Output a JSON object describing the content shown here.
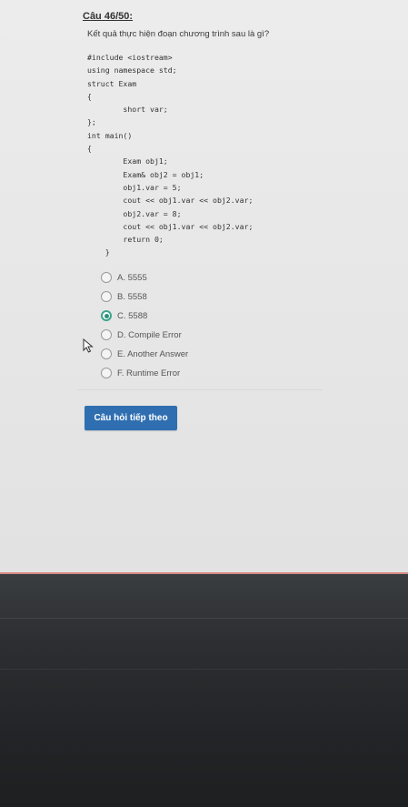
{
  "question": {
    "number": "Câu 46/50:",
    "text": "Kết quả thực hiện đoạn chương trình sau là gì?"
  },
  "code_lines": [
    "#include <iostream>",
    "using namespace std;",
    "struct Exam",
    "{",
    "        short var;",
    "};",
    "int main()",
    "{",
    "        Exam obj1;",
    "        Exam& obj2 = obj1;",
    "        obj1.var = 5;",
    "        cout << obj1.var << obj2.var;",
    "        obj2.var = 8;",
    "        cout << obj1.var << obj2.var;",
    "        return 0;",
    "    }"
  ],
  "options": [
    {
      "label": "A.  5555",
      "selected": false
    },
    {
      "label": "B.  5558",
      "selected": false
    },
    {
      "label": "C.  5588",
      "selected": true
    },
    {
      "label": "D.  Compile Error",
      "selected": false
    },
    {
      "label": "E.  Another Answer",
      "selected": false
    },
    {
      "label": "F.  Runtime Error",
      "selected": false
    }
  ],
  "next_button": {
    "label": "Câu hỏi tiếp theo"
  },
  "colors": {
    "accent": "#2f6fb1",
    "selected_radio": "#3aa48d"
  }
}
